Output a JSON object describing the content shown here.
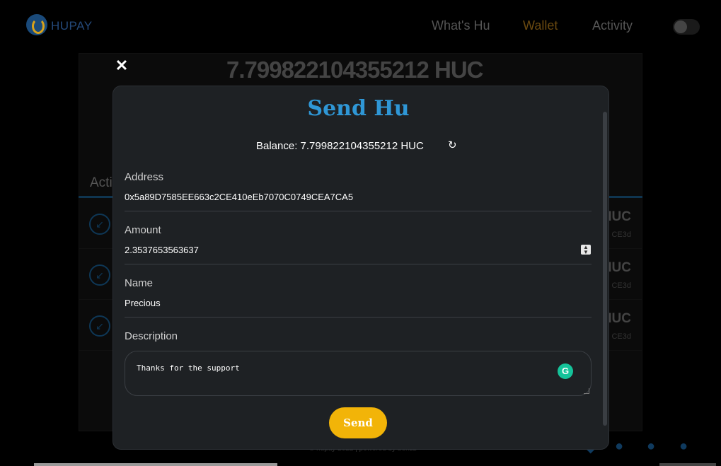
{
  "navbar": {
    "brand": "HUPAY",
    "links": [
      "What's Hu",
      "Wallet",
      "Activity"
    ]
  },
  "background": {
    "balance": "7.799822104355212 HUC",
    "activity_title": "Acti",
    "rows": [
      {
        "amount": "HUC",
        "addr": "CE3d"
      },
      {
        "amount": "HUC",
        "addr": "CE3d"
      },
      {
        "amount": "HUC",
        "addr": "CE3d"
      }
    ],
    "footer": "© hupay 2022 | powered by bonzz"
  },
  "modal": {
    "close": "✕",
    "title": "Send Hu",
    "balance_label": "Balance: 7.799822104355212 HUC",
    "refresh_icon": "↻",
    "address_label": "Address",
    "address_value": "0x5a89D7585EE663c2CE410eEb7070C0749CEA7CA5",
    "amount_label": "Amount",
    "amount_value": "2.3537653563637",
    "name_label": "Name",
    "name_value": "Precious",
    "description_label": "Description",
    "description_value": "Thanks for the support",
    "grammarly_icon": "G",
    "send_label": "Send"
  },
  "colors": {
    "accent_blue": "#2f97d6",
    "send_yellow": "#f2b408",
    "modal_bg": "#1e2124"
  }
}
